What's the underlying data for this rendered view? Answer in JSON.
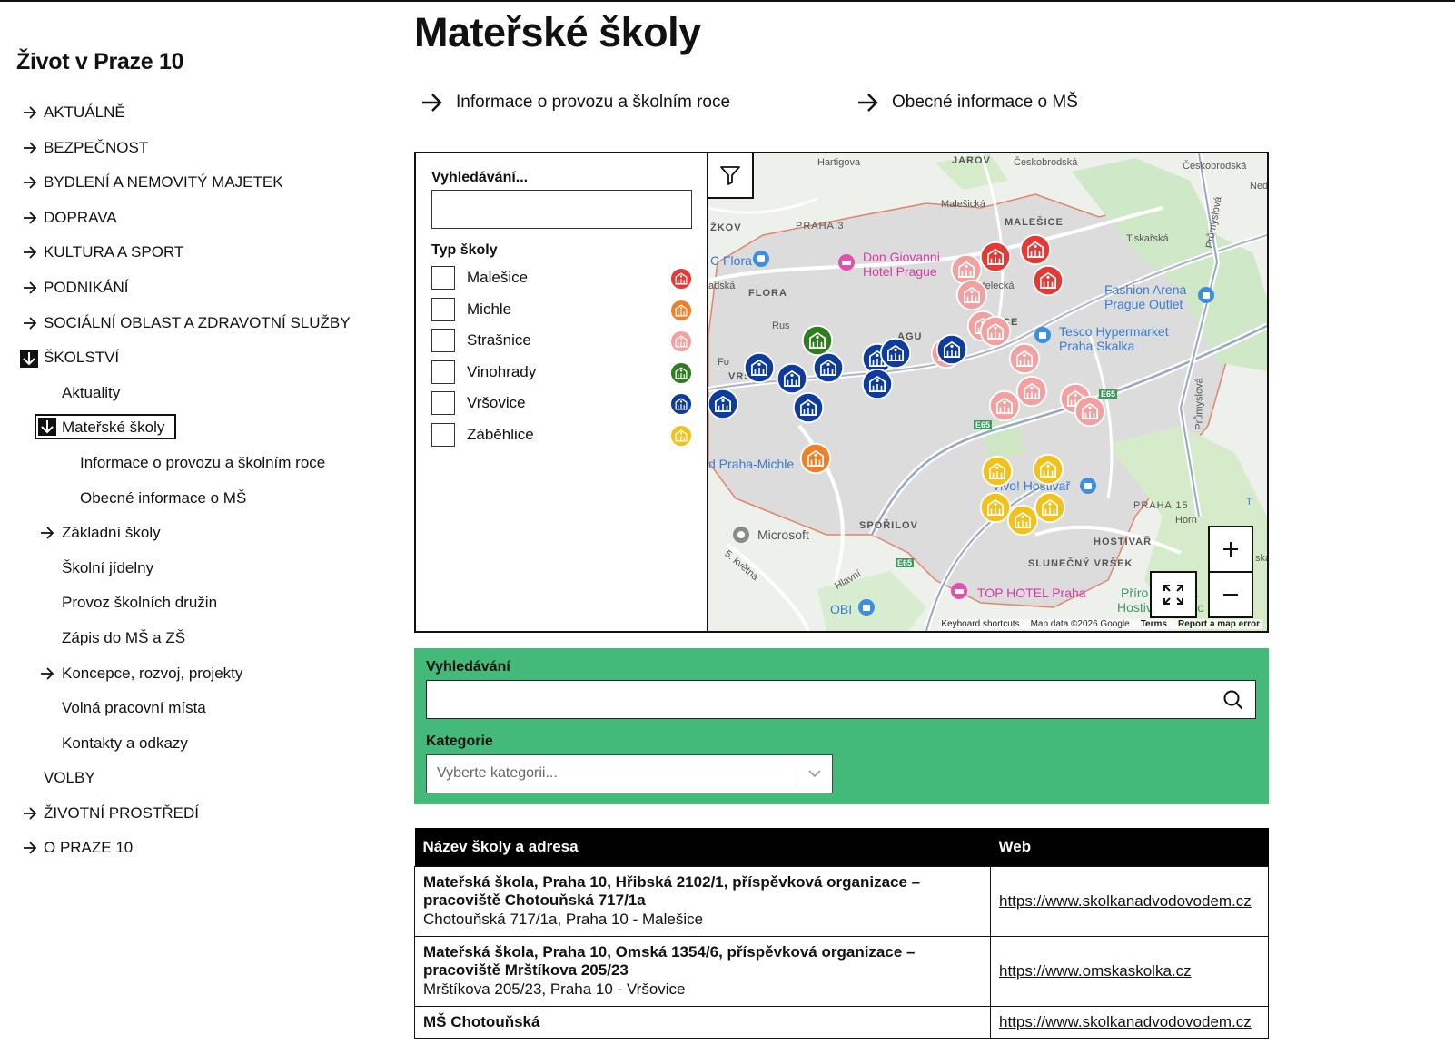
{
  "site_title": "Život v Praze 10",
  "nav": {
    "aktualne": "AKTUÁLNĚ",
    "bezpecnost": "BEZPEČNOST",
    "bydleni": "BYDLENÍ A NEMOVITÝ MAJETEK",
    "doprava": "DOPRAVA",
    "kultura": "KULTURA A SPORT",
    "podnikani": "PODNIKÁNÍ",
    "socialni": "SOCIÁLNÍ OBLAST A ZDRAVOTNÍ SLUŽBY",
    "skolstvi": "ŠKOLSTVÍ",
    "aktuality": "Aktuality",
    "materske": "Mateřské školy",
    "ms_provoz": "Informace o provozu a školním roce",
    "ms_obecne": "Obecné informace o MŠ",
    "zakladni": "Základní školy",
    "jidelny": "Školní jídelny",
    "druziny": "Provoz školních družin",
    "zapis": "Zápis do MŠ a ZŠ",
    "koncepce": "Koncepce, rozvoj, projekty",
    "volna": "Volná pracovní místa",
    "kontakty": "Kontakty a odkazy",
    "volby": "VOLBY",
    "zivotni": "ŽIVOTNÍ PROSTŘEDÍ",
    "opraze": "O PRAZE 10"
  },
  "page_title": "Mateřské školy",
  "quick_links": [
    "Informace o provozu a školním roce",
    "Obecné informace o MŠ"
  ],
  "map": {
    "search_label": "Vyhledávání...",
    "search_value": "",
    "type_label": "Typ školy",
    "types": [
      {
        "name": "Malešice",
        "color": "#e53935"
      },
      {
        "name": "Michle",
        "color": "#f07f2a"
      },
      {
        "name": "Strašnice",
        "color": "#f3a0a0"
      },
      {
        "name": "Vinohrady",
        "color": "#2e7d1e"
      },
      {
        "name": "Vršovice",
        "color": "#0d3b9e"
      },
      {
        "name": "Záběhlice",
        "color": "#f2c21b"
      }
    ],
    "labels": {
      "hartigova": "Hartigova",
      "jarov": "JAROV",
      "ceskobrodska": "Českobrodská",
      "ceskobrodska2": "Českobrodská",
      "zizkov": "ŽKOV",
      "praha3": "PRAHA 3",
      "malesicka": "Malešická",
      "malesice": "MALEŠICE",
      "tiskarska": "Tiskařská",
      "flora_poi": "C Flora",
      "don_giovanni": "Don Giovanni",
      "hotel_prague": "Hotel Prague",
      "flora": "FLORA",
      "zadska": "adská",
      "kostelecka": "ostelecká",
      "fashion_arena": "Fashion Arena",
      "prague_outlet": "Prague Outlet",
      "tesco": "Tesco Hypermarket",
      "praha_skalka": "Praha Skalka",
      "vrsovice": "VRŠO",
      "ice": "ICE",
      "e65a": "E65",
      "e65b": "E65",
      "e65c": "E65",
      "praha_michle": "d Praha-Michle",
      "vivo": "Vivo! Hostivař",
      "praha15": "PRAHA 15",
      "microsoft": "Microsoft",
      "sporilov": "SPOŘILOV",
      "hostivar": "HOSTIVAŘ",
      "slunecny": "SLUNEČNÝ VRŠEK",
      "kvetna": "5. května",
      "hlavni": "Hlavní",
      "top_hotel": "TOP HOTEL Praha",
      "obi": "OBI",
      "hostiva": "Hostiva",
      "priro": "Přírо",
      "prumyslova": "Průmyslová",
      "prumyslova2": "Průmyslová",
      "hornomericka": "Horn",
      "ned": "Nedo",
      "rus": "Rus",
      "fo": "Fo",
      "agu": "AGU",
      "t": "T",
      "ska": "ska",
      "va": "va",
      "k": "k",
      "lic": "lic"
    },
    "attribution": [
      "Keyboard shortcuts",
      "Map data ©2026 Google",
      "Terms",
      "Report a map error"
    ]
  },
  "search": {
    "label": "Vyhledávání",
    "value": "",
    "category_label": "Kategorie",
    "category_placeholder": "Vyberte kategorii..."
  },
  "table": {
    "headers": [
      "Název školy a adresa",
      "Web"
    ],
    "rows": [
      {
        "name": "Mateřská škola, Praha 10, Hřibská 2102/1, příspěvková organizace – pracoviště Chotouňská 717/1a",
        "address": "Chotouňská 717/1a, Praha 10 - Malešice",
        "web": "https://www.skolkanadvodovodem.cz"
      },
      {
        "name": "Mateřská škola, Praha 10, Omská 1354/6, příspěvková organizace – pracoviště Mrštíkova 205/23",
        "address": "Mrštíkova 205/23, Praha 10 - Vršovice",
        "web": "https://www.omskaskolka.cz"
      },
      {
        "name": "MŠ Chotouňská",
        "address": "",
        "web": "https://www.skolkanadvodovodem.cz"
      }
    ]
  }
}
